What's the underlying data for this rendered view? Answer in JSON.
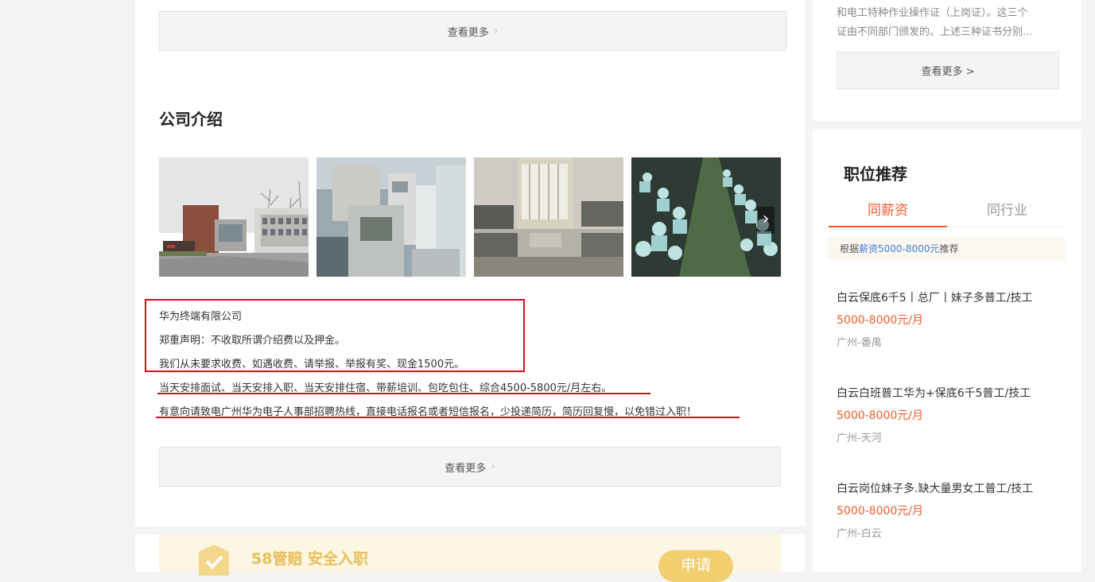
{
  "top_more_label": "查看更多",
  "company": {
    "title": "公司介绍",
    "photos": [
      {
        "icon": "building-photo"
      },
      {
        "icon": "machine-photo"
      },
      {
        "icon": "dormitory-photo"
      },
      {
        "icon": "workshop-photo"
      }
    ],
    "next_arrow": "›",
    "lines": [
      "华为终端有限公司",
      "郑重声明：不收取所谓介绍费以及押金。",
      "我们从未要求收费、如遇收费、请举报、举报有奖、现金1500元。",
      "当天安排面试、当天安排入职、当天安排住宿、带薪培训、包吃包住、综合4500-5800元/月左右。",
      "有意向请致电广州华为电子人事部招聘热线，直接电话报名或者短信报名，少投递简历，简历回复慢，以免错过入职！"
    ],
    "more_label": "查看更多"
  },
  "guarantee": {
    "title": "58管赔 安全入职",
    "apply_label": "申请",
    "icon": "shield-check-icon"
  },
  "sidebar": {
    "cert_text_1": "和电工特种作业操作证（上岗证）。这三个",
    "cert_text_2": "证由不同部门颁发的。上述三种证书分别...",
    "cert_more_label": "查看更多 >",
    "rec_title": "职位推荐",
    "tabs": [
      "同薪资",
      "同行业"
    ],
    "active_tab": 0,
    "basis_prefix": "根据",
    "basis_link": "薪资5000-8000元",
    "basis_suffix": "推荐",
    "jobs": [
      {
        "title": "白云保底6千5丨总厂丨妹子多普工/技工",
        "salary": "5000-8000元/月",
        "location": "广州-番禺"
      },
      {
        "title": "白云白班普工华为+保底6千5普工/技工",
        "salary": "5000-8000元/月",
        "location": "广州-天河"
      },
      {
        "title": "白云岗位妹子多.缺大量男女工普工/技工",
        "salary": "5000-8000元/月",
        "location": "广州-白云"
      }
    ]
  },
  "colors": {
    "accent": "#f05a2c",
    "link": "#3a7fd5",
    "annotation_red": "#d9101a",
    "page_bg": "#f4f4f4"
  }
}
